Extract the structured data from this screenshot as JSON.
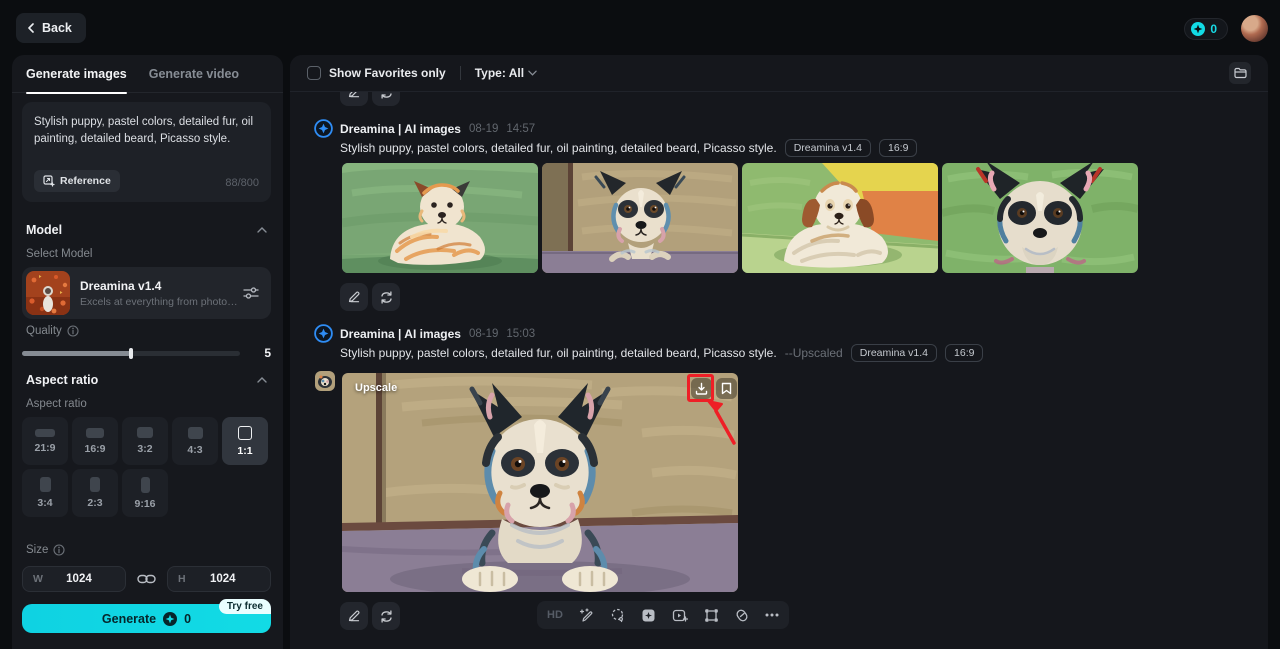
{
  "header": {
    "back_label": "Back",
    "credits": "0"
  },
  "sidebar": {
    "tabs": [
      {
        "label": "Generate images"
      },
      {
        "label": "Generate video"
      }
    ],
    "prompt": {
      "value": "Stylish puppy, pastel colors, detailed fur, oil painting, detailed beard, Picasso style.",
      "reference_label": "Reference",
      "counter": "88/800"
    },
    "model": {
      "section_label": "Model",
      "select_label": "Select Model",
      "name": "Dreamina v1.4",
      "description": "Excels at everything from photorealis..."
    },
    "quality": {
      "label": "Quality",
      "value": "5"
    },
    "aspect": {
      "section_label": "Aspect ratio",
      "sub_label": "Aspect ratio",
      "options": [
        "21:9",
        "16:9",
        "3:2",
        "4:3",
        "1:1",
        "3:4",
        "2:3",
        "9:16"
      ],
      "selected": "1:1"
    },
    "size": {
      "label": "Size",
      "w_label": "W",
      "w_value": "1024",
      "h_label": "H",
      "h_value": "1024"
    },
    "generate": {
      "label": "Generate",
      "credits": "0",
      "badge": "Try free"
    }
  },
  "filterbar": {
    "favorites_label": "Show Favorites only",
    "type_label": "Type: All"
  },
  "feed": {
    "entries": [
      {
        "source": "Dreamina | AI images",
        "date": "08-19",
        "time": "14:57",
        "prompt": "Stylish puppy, pastel colors, detailed fur, oil painting, detailed beard, Picasso style.",
        "badges": [
          "Dreamina v1.4",
          "16:9"
        ]
      },
      {
        "source": "Dreamina | AI images",
        "date": "08-19",
        "time": "15:03",
        "prompt": "Stylish puppy, pastel colors, detailed fur, oil painting, detailed beard, Picasso style.",
        "suffix": "--Upscaled",
        "badges": [
          "Dreamina v1.4",
          "16:9"
        ],
        "overlay_label": "Upscale"
      }
    ],
    "toolbar": {
      "hd_label": "HD"
    }
  },
  "icons": {
    "names": [
      "chevron-left",
      "coin",
      "avatar",
      "reference",
      "chevron-up",
      "info",
      "sliders",
      "link",
      "checkbox",
      "chevron-down",
      "folder-panel",
      "dreamina-logo",
      "edit-pencil",
      "regenerate",
      "download",
      "bookmark",
      "retouch",
      "lasso",
      "inpaint",
      "animate",
      "crop",
      "attach",
      "more"
    ]
  },
  "colors": {
    "accent_cyan": "#12dbe5",
    "annotation_red": "#ee1f26",
    "logo_blue": "#2f8df5"
  }
}
